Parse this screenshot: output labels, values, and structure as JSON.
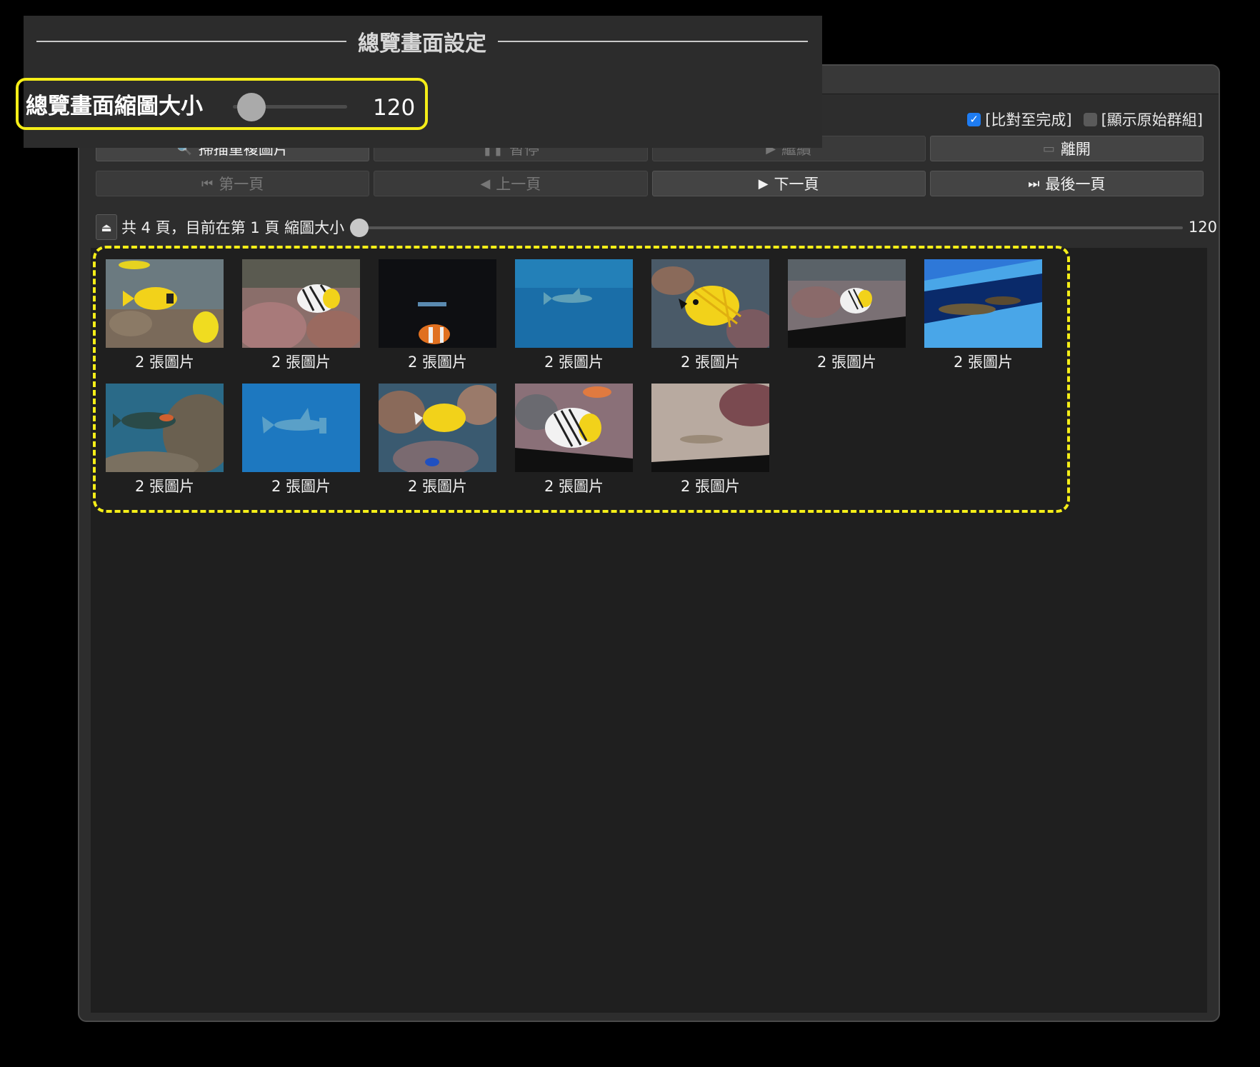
{
  "panel": {
    "title": "總覽畫面設定",
    "setting_label": "總覽畫面縮圖大小",
    "thumb_size": "120"
  },
  "options": {
    "compare_until_done": {
      "label": "[比對至完成]",
      "checked": true
    },
    "show_original_groups": {
      "label": "[顯示原始群組]",
      "checked": false
    }
  },
  "toolbar": {
    "scan_label": "掃描重複圖片",
    "pause_label": "暫停",
    "continue_label": "繼續",
    "exit_label": "離開"
  },
  "pagination": {
    "first_label": "第一頁",
    "prev_label": "上一頁",
    "next_label": "下一頁",
    "last_label": "最後一頁"
  },
  "status": {
    "text": "共 4 頁，目前在第 1 頁 縮圖大小",
    "thumb_size": "120"
  },
  "thumbnails": [
    {
      "caption": "2 張圖片",
      "icon": "fish-photo-yellow-rabbitfish"
    },
    {
      "caption": "2 張圖片",
      "icon": "fish-photo-butterflyfish-reef"
    },
    {
      "caption": "2 張圖片",
      "icon": "fish-photo-dark-clownfish"
    },
    {
      "caption": "2 張圖片",
      "icon": "fish-photo-shark-blue"
    },
    {
      "caption": "2 張圖片",
      "icon": "fish-photo-yellow-foxface"
    },
    {
      "caption": "2 張圖片",
      "icon": "fish-photo-butterflyfish-tank"
    },
    {
      "caption": "2 張圖片",
      "icon": "fish-photo-tank-bottom"
    },
    {
      "caption": "2 張圖片",
      "icon": "fish-photo-parrotfish-reef"
    },
    {
      "caption": "2 張圖片",
      "icon": "fish-photo-hammerhead"
    },
    {
      "caption": "2 張圖片",
      "icon": "fish-photo-yellow-tang-reef"
    },
    {
      "caption": "2 張圖片",
      "icon": "fish-photo-threadfin-butterflyfish"
    },
    {
      "caption": "2 張圖片",
      "icon": "fish-photo-sand-floor"
    }
  ],
  "colors": {
    "highlight": "#f5ee18",
    "accent": "#1e7cf2"
  }
}
